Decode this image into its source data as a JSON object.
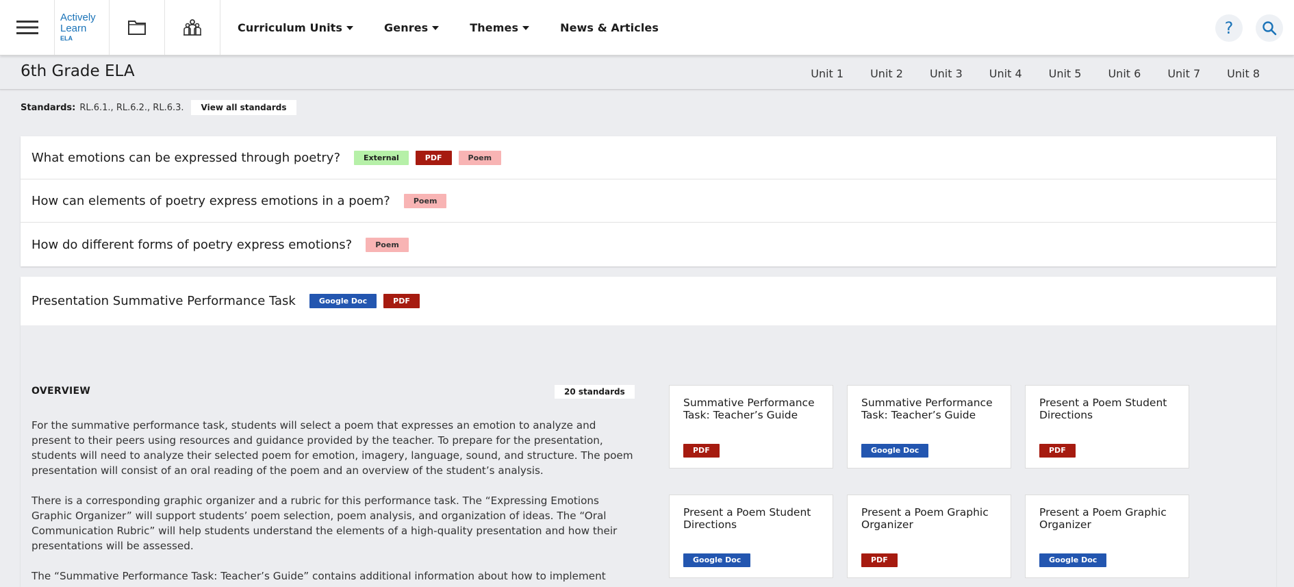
{
  "nav": {
    "logo_line1": "Actively",
    "logo_line2": "Learn",
    "logo_sub": "ELA",
    "links": [
      "Curriculum Units",
      "Genres",
      "Themes",
      "News & Articles"
    ],
    "help_label": "?",
    "icons": [
      "hamburger-menu-icon",
      "folder-icon",
      "classroom-icon",
      "help-icon",
      "search-icon"
    ]
  },
  "subheader": {
    "title": "6th Grade ELA",
    "units": [
      "Unit 1",
      "Unit 2",
      "Unit 3",
      "Unit 4",
      "Unit 5",
      "Unit 6",
      "Unit 7",
      "Unit 8"
    ]
  },
  "standards": {
    "label": "Standards:",
    "value": "RL.6.1., RL.6.2., RL.6.3.",
    "button": "View all standards"
  },
  "questions": [
    {
      "text": "What emotions can be expressed through poetry?",
      "tags": [
        "External",
        "PDF",
        "Poem"
      ]
    },
    {
      "text": "How can elements of poetry express emotions in a poem?",
      "tags": [
        "Poem"
      ]
    },
    {
      "text": "How do different forms of poetry express emotions?",
      "tags": [
        "Poem"
      ]
    }
  ],
  "task": {
    "title": "Presentation Summative Performance Task",
    "tags": [
      "Google Doc",
      "PDF"
    ],
    "overview_title": "OVERVIEW",
    "standards_count": "20 standards",
    "paragraphs": [
      "For the summative performance task, students will select a poem that expresses an emotion to analyze and present to their peers using resources and guidance provided by the teacher. To prepare for the presentation, students will need to analyze their selected poem for emotion, imagery, language, sound, and structure. The poem presentation will consist of an oral reading of the poem and an overview of the student’s analysis.",
      "There is a corresponding graphic organizer and a rubric for this performance task. The “Expressing Emotions Graphic Organizer” will support students’ poem selection, poem analysis, and organization of ideas. The “Oral Communication Rubric” will help students understand the elements of a high-quality presentation and how their presentations will be assessed.",
      "The “Summative Performance Task: Teacher’s Guide” contains additional information about how to implement"
    ],
    "resources": [
      {
        "title": "Summative Performance Task: Teacher’s Guide",
        "tag": "PDF"
      },
      {
        "title": "Summative Performance Task: Teacher’s Guide",
        "tag": "Google Doc"
      },
      {
        "title": "Present a Poem Student Directions",
        "tag": "PDF"
      },
      {
        "title": "Present a Poem Student Directions",
        "tag": "Google Doc"
      },
      {
        "title": "Present a Poem Graphic Organizer",
        "tag": "PDF"
      },
      {
        "title": "Present a Poem Graphic Organizer",
        "tag": "Google Doc"
      }
    ]
  },
  "colors": {
    "brand_blue": "#1a73b8",
    "pdf_red": "#a61b10",
    "gdoc_blue": "#2356b0",
    "external_green": "#b6f0a8",
    "poem_pink": "#f8b4b4"
  }
}
